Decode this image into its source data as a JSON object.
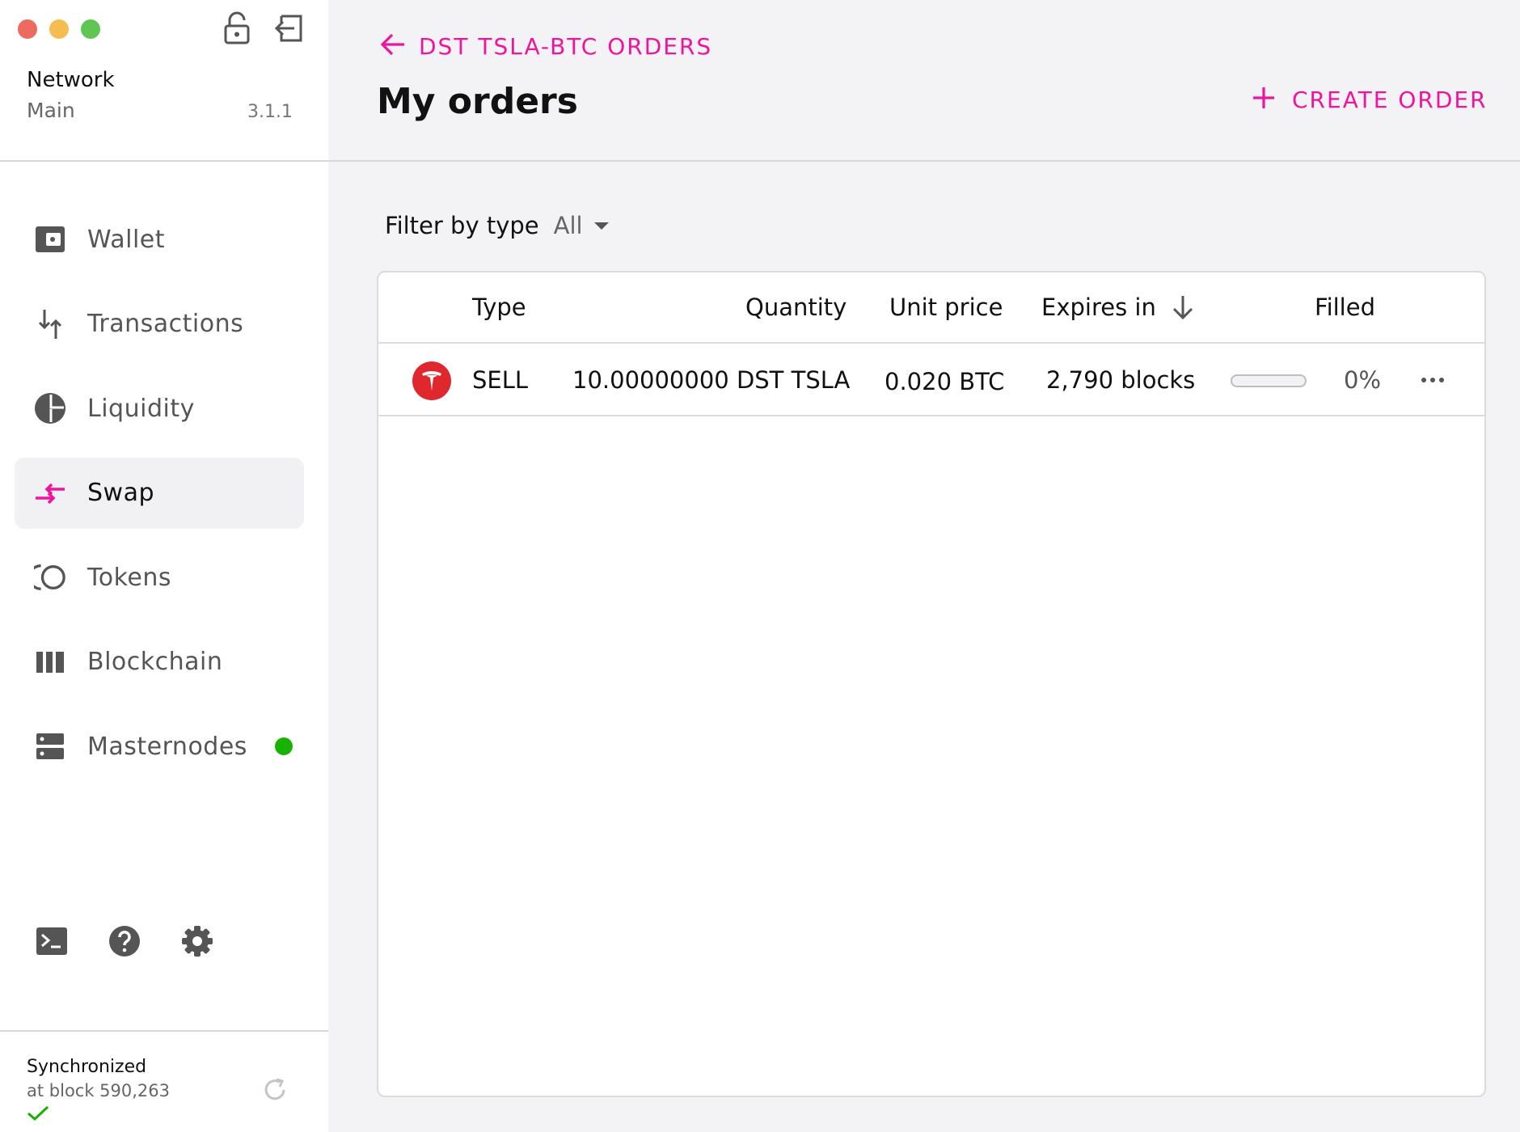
{
  "window": {
    "controls": [
      "close",
      "minimize",
      "maximize"
    ]
  },
  "sidebar": {
    "network_label": "Network",
    "network_value": "Main",
    "version": "3.1.1",
    "top_icons": [
      "lock-icon",
      "logout-icon"
    ],
    "items": [
      {
        "label": "Wallet",
        "icon": "wallet-icon",
        "active": false
      },
      {
        "label": "Transactions",
        "icon": "transactions-icon",
        "active": false
      },
      {
        "label": "Liquidity",
        "icon": "liquidity-icon",
        "active": false
      },
      {
        "label": "Swap",
        "icon": "swap-icon",
        "active": true
      },
      {
        "label": "Tokens",
        "icon": "tokens-icon",
        "active": false
      },
      {
        "label": "Blockchain",
        "icon": "blockchain-icon",
        "active": false
      },
      {
        "label": "Masternodes",
        "icon": "masternodes-icon",
        "active": false,
        "status": "online"
      }
    ],
    "bottom_tools": [
      "terminal-icon",
      "help-icon",
      "settings-icon"
    ],
    "sync": {
      "title": "Synchronized",
      "subtitle": "at block 590,263"
    }
  },
  "header": {
    "back_label": "DST TSLA-BTC ORDERS",
    "title": "My orders",
    "create_label": "CREATE ORDER"
  },
  "filter": {
    "label": "Filter by type",
    "value": "All"
  },
  "table": {
    "columns": [
      "Type",
      "Quantity",
      "Unit price",
      "Expires in",
      "Filled"
    ],
    "sort_column": "Expires in",
    "rows": [
      {
        "token_icon": "tesla-logo-icon",
        "type": "SELL",
        "quantity": "10.00000000 DST TSLA",
        "unit_price": "0.020 BTC",
        "expires_in": "2,790 blocks",
        "filled_fraction": 0,
        "filled": "0%"
      }
    ]
  },
  "colors": {
    "accent": "#f0139e",
    "status_online": "#17b300",
    "tesla_red": "#e0272e"
  }
}
